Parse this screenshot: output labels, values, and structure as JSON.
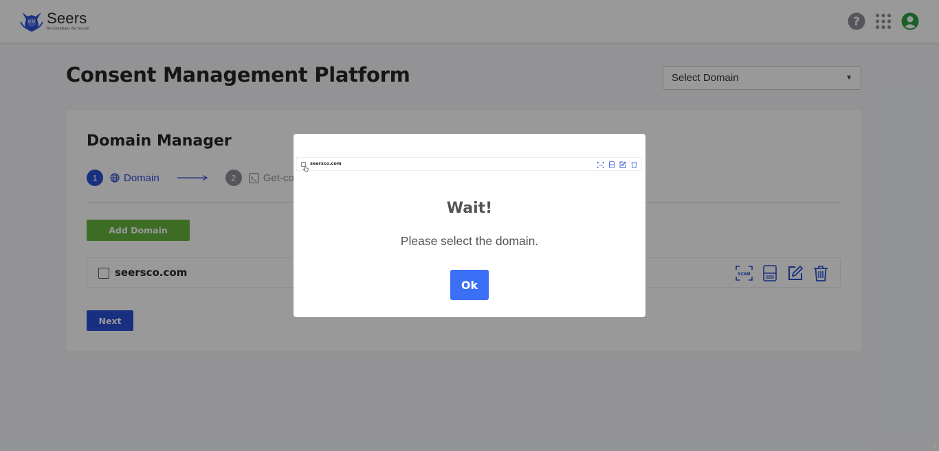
{
  "header": {
    "logo_name": "Seers",
    "logo_tagline": "Be Compliant, Be Secure",
    "icons": [
      "help-icon",
      "apps-grid-icon",
      "user-avatar-icon"
    ]
  },
  "page": {
    "title": "Consent Management Platform",
    "domain_select": {
      "value": "Select Domain",
      "options_visible": [
        "Select Domain"
      ]
    }
  },
  "domain_manager": {
    "title": "Domain Manager",
    "steps": [
      {
        "number": "1",
        "label": "Domain",
        "icon": "globe-icon",
        "state": "active"
      },
      {
        "number": "2",
        "label": "Get-co",
        "icon": "terminal-icon",
        "state": "inactive"
      }
    ],
    "add_button_label": "Add Domain",
    "rows": [
      {
        "name": "seersco.com",
        "checked": false,
        "actions": [
          "scan-icon",
          "save-icon",
          "edit-icon",
          "trash-icon"
        ]
      }
    ],
    "next_button_label": "Next"
  },
  "modal": {
    "preview": {
      "domain": "seersco.com"
    },
    "title": "Wait!",
    "message": "Please select the domain.",
    "ok_label": "Ok"
  },
  "colors": {
    "primary": "#2b4fd6",
    "success": "#66b53f",
    "modal_button": "#3b6ff5",
    "avatar": "#2f9e44",
    "overlay": "rgba(0,0,0,0.4)"
  }
}
